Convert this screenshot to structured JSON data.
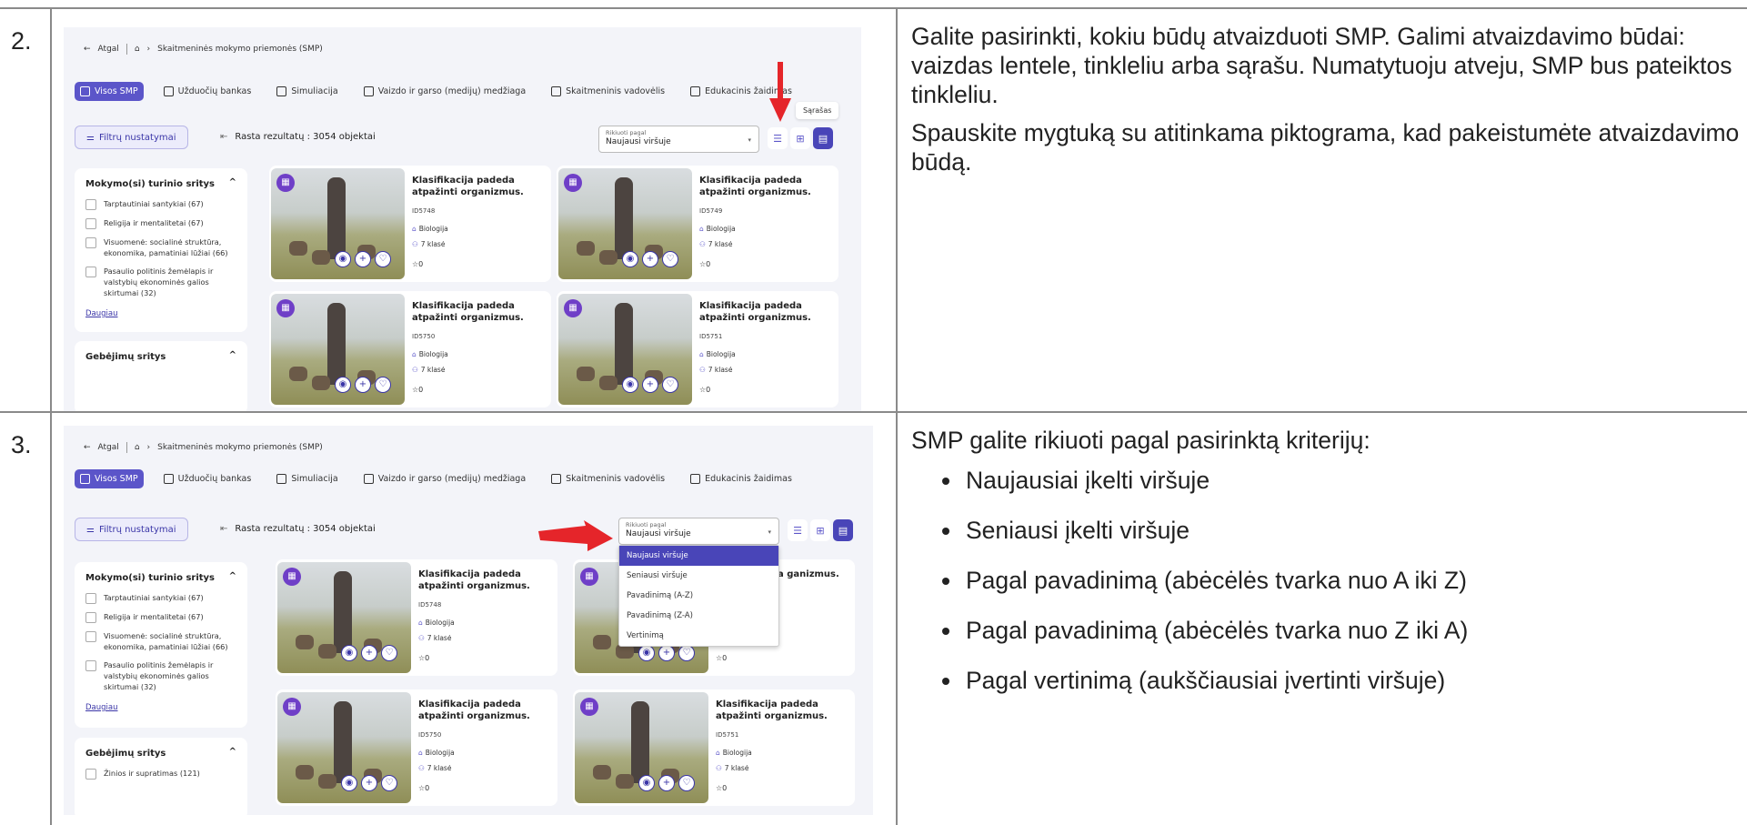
{
  "rows": [
    {
      "number": "2.",
      "paragraphs": [
        "Galite pasirinkti, kokiu būdų atvaizduoti SMP. Galimi atvaizdavimo būdai: vaizdas lentele, tinkleliu arba sąrašu. Numatytuoju atveju, SMP bus pateiktos tinkleliu.",
        "Spauskite mygtuką su atitinkama piktograma, kad pakeistumėte atvaizdavimo būdą."
      ]
    },
    {
      "number": "3.",
      "intro": "SMP galite rikiuoti pagal pasirinktą kriterijų:",
      "bullets": [
        "Naujausiai įkelti viršuje",
        "Seniausi įkelti viršuje",
        "Pagal pavadinimą (abėcėlės tvarka nuo A iki Z)",
        "Pagal pavadinimą (abėcėlės tvarka nuo Z iki A)",
        "Pagal vertinimą (aukščiausiai įvertinti viršuje)"
      ]
    }
  ],
  "app": {
    "back": "Atgal",
    "breadcrumb": "Skaitmeninės mokymo priemonės (SMP)",
    "tabs": [
      "Visos SMP",
      "Užduočių bankas",
      "Simuliacija",
      "Vaizdo ir garso (medijų) medžiaga",
      "Skaitmeninis vadovėlis",
      "Edukacinis žaidimas"
    ],
    "filter_button": "Filtrų nustatymai",
    "results_label": "Rasta rezultatų :",
    "results_count": "3054 objektai",
    "sort_label": "Rikiuoti pagal",
    "sort_value": "Naujausi viršuje",
    "tooltip": "Sąrašas",
    "sidebar": {
      "section1": "Mokymo(si) turinio sritys",
      "items": [
        "Tarptautiniai santykiai (67)",
        "Religija ir mentalitetai (67)",
        "Visuomenė: socialinė struktūra, ekonomika, pamatiniai lūžiai (66)",
        "Pasaulio politinis žemėlapis ir valstybių ekonominės galios skirtumai (32)"
      ],
      "more": "Daugiau",
      "section2": "Gebėjimų sritys",
      "section2_item": "Žinios ir supratimas (121)"
    },
    "cards": [
      {
        "title": "Klasifikacija padeda atpažinti organizmus.",
        "id": "ID5748",
        "subject": "Biologija",
        "grade": "7 klasė",
        "rating": "0"
      },
      {
        "title": "Klasifikacija padeda atpažinti organizmus.",
        "id": "ID5749",
        "subject": "Biologija",
        "grade": "7 klasė",
        "rating": "0"
      },
      {
        "title": "Klasifikacija padeda atpažinti organizmus.",
        "id": "ID5750",
        "subject": "Biologija",
        "grade": "7 klasė",
        "rating": "0"
      },
      {
        "title": "Klasifikacija padeda atpažinti organizmus.",
        "id": "ID5751",
        "subject": "Biologija",
        "grade": "7 klasė",
        "rating": "0"
      }
    ],
    "card2_partial_title": "padeda ganizmus.",
    "sort_options": [
      "Naujausi viršuje",
      "Seniausi viršuje",
      "Pavadinimą (A-Z)",
      "Pavadinimą (Z-A)",
      "Vertinimą"
    ]
  },
  "colors": {
    "accent": "#5b55c9",
    "arrow": "#e5252a",
    "border": "#8a8a8a"
  }
}
